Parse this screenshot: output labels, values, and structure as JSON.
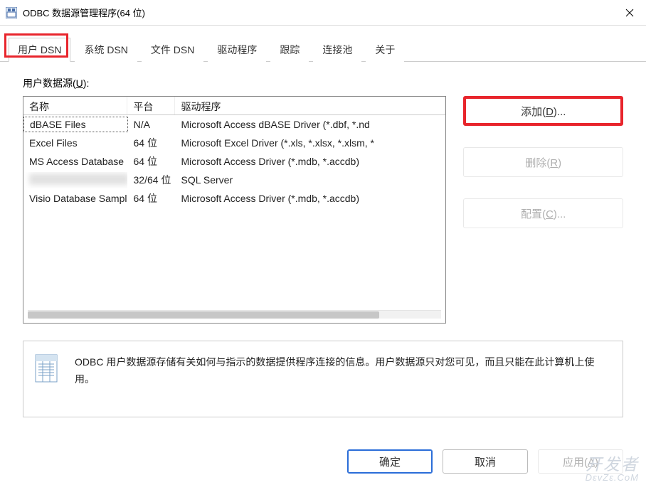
{
  "window": {
    "title": "ODBC 数据源管理程序(64 位)",
    "close": "×"
  },
  "tabs": [
    {
      "label": "用户 DSN",
      "active": true
    },
    {
      "label": "系统 DSN"
    },
    {
      "label": "文件 DSN"
    },
    {
      "label": "驱动程序"
    },
    {
      "label": "跟踪"
    },
    {
      "label": "连接池"
    },
    {
      "label": "关于"
    }
  ],
  "content": {
    "listLabel_pre": "用户数据源(",
    "listLabel_u": "U",
    "listLabel_post": "):",
    "columns": {
      "name": "名称",
      "platform": "平台",
      "driver": "驱动程序"
    },
    "rows": [
      {
        "name": "dBASE Files",
        "platform": "N/A",
        "driver": "Microsoft Access dBASE Driver (*.dbf, *.nd",
        "selected": true
      },
      {
        "name": "Excel Files",
        "platform": "64 位",
        "driver": "Microsoft Excel Driver (*.xls, *.xlsx, *.xlsm, *"
      },
      {
        "name": "MS Access Database",
        "platform": "64 位",
        "driver": "Microsoft Access Driver (*.mdb, *.accdb)"
      },
      {
        "name": "",
        "platform": "32/64 位",
        "driver": "SQL Server",
        "blurred": true
      },
      {
        "name": "Visio Database Samples",
        "platform": "64 位",
        "driver": "Microsoft Access Driver (*.mdb, *.accdb)"
      }
    ]
  },
  "buttons": {
    "add_pre": "添加(",
    "add_u": "D",
    "add_post": ")...",
    "remove_pre": "删除(",
    "remove_u": "R",
    "remove_post": ")",
    "configure_pre": "配置(",
    "configure_u": "C",
    "configure_post": ")..."
  },
  "info": {
    "text": "ODBC 用户数据源存储有关如何与指示的数据提供程序连接的信息。用户数据源只对您可见，而且只能在此计算机上使用。"
  },
  "footer": {
    "ok": "确定",
    "cancel": "取消",
    "apply_pre": "应用(",
    "apply_u": "A",
    "apply_post": ")"
  },
  "watermark": {
    "line1": "开发者",
    "line2": "DεvZε.CoM"
  }
}
